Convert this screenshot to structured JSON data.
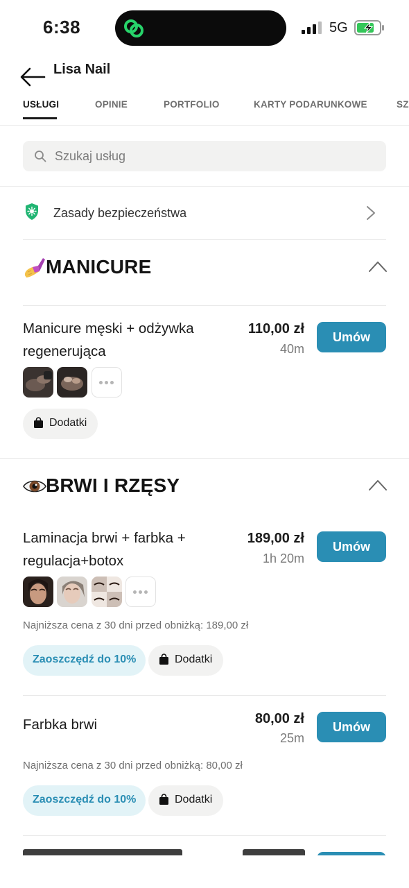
{
  "status": {
    "time": "6:38",
    "network": "5G"
  },
  "header": {
    "title": "Lisa Nail",
    "tabs": [
      "USŁUGI",
      "OPINIE",
      "PORTFOLIO",
      "KARTY PODARUNKOWE",
      "SZ"
    ]
  },
  "search": {
    "placeholder": "Szukaj usług"
  },
  "safety": {
    "label": "Zasady bezpieczeństwa"
  },
  "sections": [
    {
      "title": "MANICURE",
      "icon": "nail-polish-icon",
      "services": [
        {
          "name": "Manicure męski + odżywka regenerująca",
          "price": "110,00 zł",
          "duration": "40m",
          "book_label": "Umów",
          "addons_label": "Dodatki"
        }
      ]
    },
    {
      "title": "BRWI I RZĘSY",
      "icon": "eye-icon",
      "services": [
        {
          "name": "Laminacja brwi + farbka + regulacja+botox",
          "price": "189,00 zł",
          "duration": "1h 20m",
          "book_label": "Umów",
          "lowest_price": "Najniższa cena z 30 dni przed obniżką: 189,00 zł",
          "promo": "Zaoszczędź do 10%",
          "addons_label": "Dodatki"
        },
        {
          "name": "Farbka brwi",
          "price": "80,00 zł",
          "duration": "25m",
          "book_label": "Umów",
          "lowest_price": "Najniższa cena z 30 dni przed obniżką: 80,00 zł",
          "promo": "Zaoszczędź do 10%",
          "addons_label": "Dodatki"
        }
      ]
    }
  ],
  "colors": {
    "accent": "#2a8eb4",
    "promo_bg": "#e2f3f7",
    "pill_bg": "#f2f2f1"
  }
}
